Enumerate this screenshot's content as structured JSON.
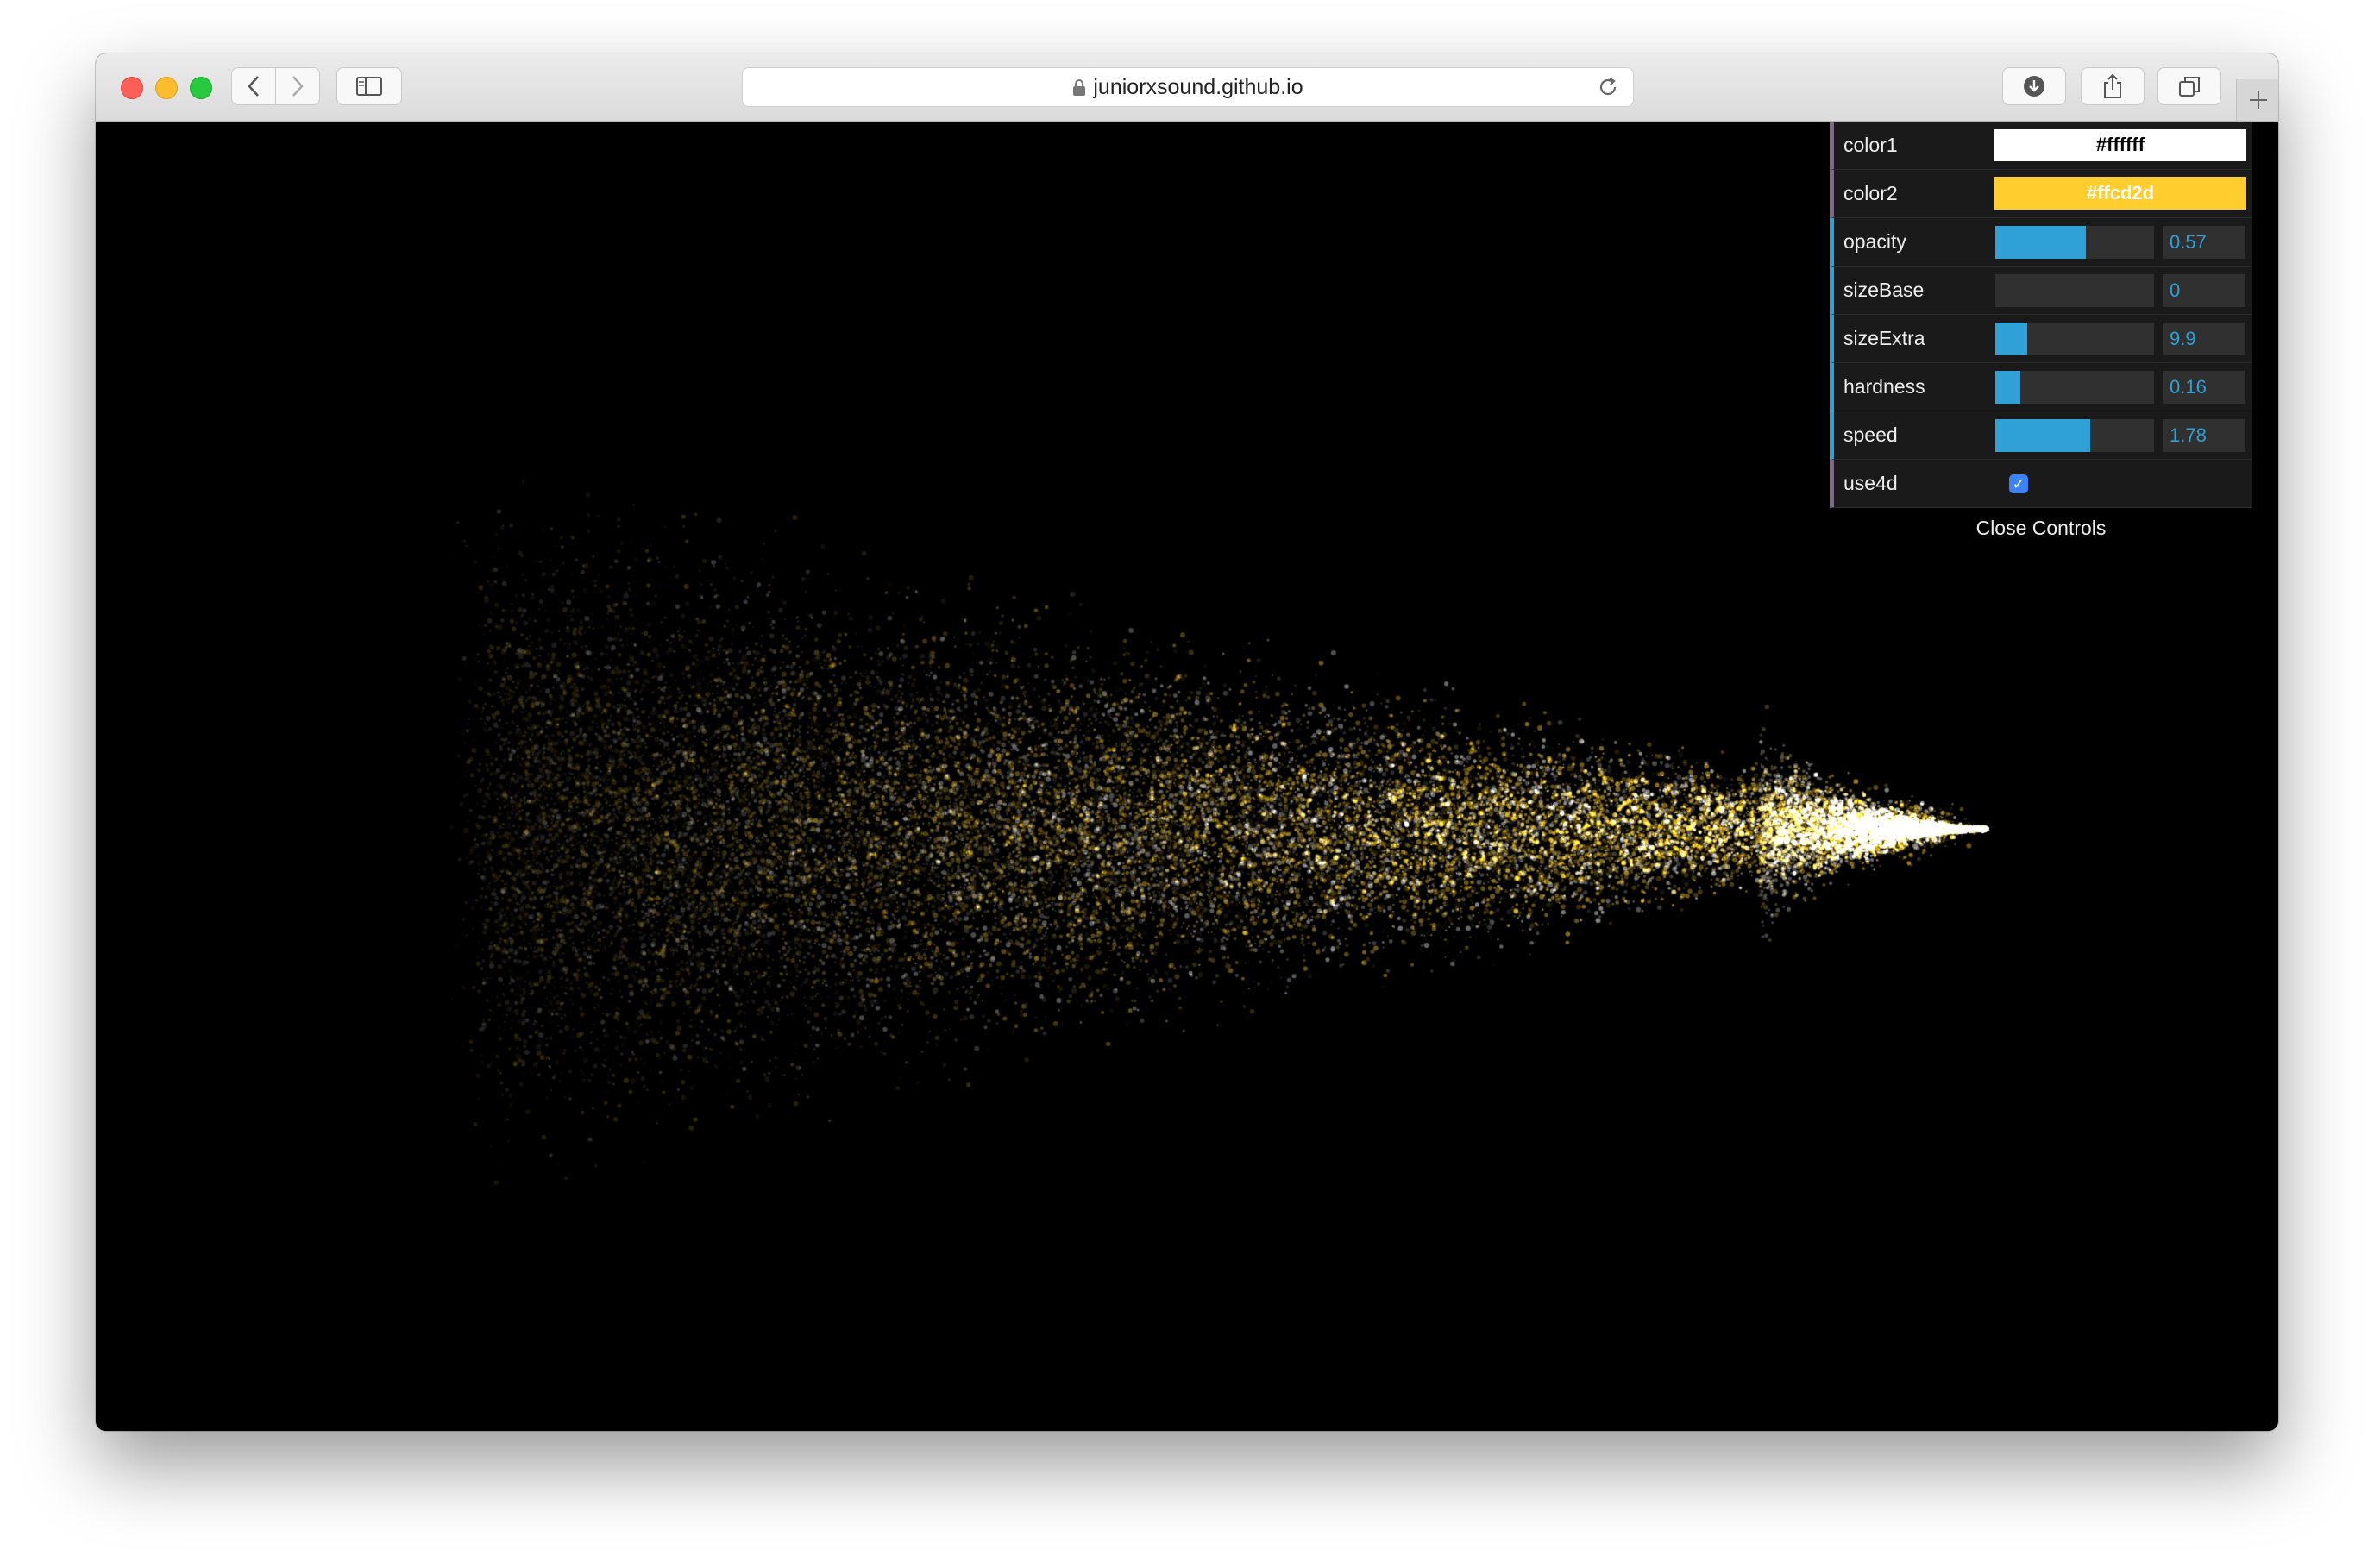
{
  "browser": {
    "url": "juniorxsound.github.io"
  },
  "visualization": {
    "color1": "#ffffff",
    "color2": "#ffcd2d",
    "background": "#000000"
  },
  "controls": {
    "accent": "#2fa1d6",
    "color1": {
      "label": "color1",
      "value": "#ffffff"
    },
    "color2": {
      "label": "color2",
      "value": "#ffcd2d"
    },
    "opacity": {
      "label": "opacity",
      "value": "0.57",
      "fill": 0.57
    },
    "sizeBase": {
      "label": "sizeBase",
      "value": "0",
      "fill": 0.0
    },
    "sizeExtra": {
      "label": "sizeExtra",
      "value": "9.9",
      "fill": 0.2
    },
    "hardness": {
      "label": "hardness",
      "value": "0.16",
      "fill": 0.16
    },
    "speed": {
      "label": "speed",
      "value": "1.78",
      "fill": 0.6
    },
    "use4d": {
      "label": "use4d",
      "checked": true
    },
    "close_label": "Close Controls"
  }
}
